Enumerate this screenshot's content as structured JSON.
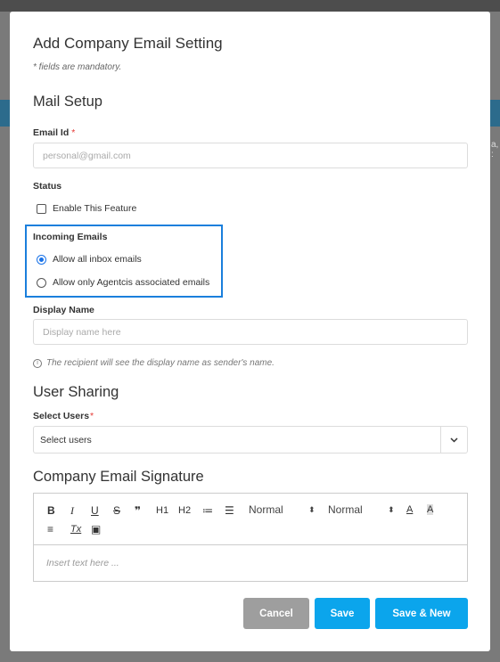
{
  "background": {
    "partial_text": "a, :"
  },
  "modal": {
    "title": "Add Company Email Setting",
    "mandatory_note": "* fields are mandatory."
  },
  "mail_setup": {
    "heading": "Mail Setup",
    "email_label": "Email Id",
    "required_mark": "*",
    "email_placeholder": "personal@gmail.com",
    "email_value": ""
  },
  "status": {
    "label": "Status",
    "checkbox_label": "Enable This Feature",
    "checked": false
  },
  "incoming": {
    "label": "Incoming Emails",
    "options": [
      {
        "label": "Allow all inbox emails",
        "selected": true
      },
      {
        "label": "Allow only Agentcis associated emails",
        "selected": false
      }
    ],
    "highlight_color": "#1a7fdc"
  },
  "display_name": {
    "label": "Display Name",
    "placeholder": "Display name here",
    "value": "",
    "hint": "The recipient will see the display name as sender's name."
  },
  "user_sharing": {
    "heading": "User Sharing",
    "select_label": "Select Users",
    "required_mark": "*",
    "select_value": "Select users"
  },
  "signature": {
    "heading": "Company Email Signature",
    "toolbar": {
      "bold": "B",
      "italic": "I",
      "underline": "U",
      "strike": "S",
      "quote": "❞",
      "h1": "H1",
      "h2": "H2",
      "ordered_list": "≔",
      "bullet_list": "☰",
      "font_select": "Normal",
      "size_select": "Normal",
      "text_color": "A",
      "background_color": "A",
      "align": "≡",
      "clear_format": "Tx",
      "image": "▣"
    },
    "placeholder": "Insert text here ..."
  },
  "buttons": {
    "cancel": "Cancel",
    "save": "Save",
    "save_new": "Save & New"
  },
  "colors": {
    "primary": "#0ba5ec",
    "cancel": "#9e9e9e",
    "required": "#e53935"
  }
}
